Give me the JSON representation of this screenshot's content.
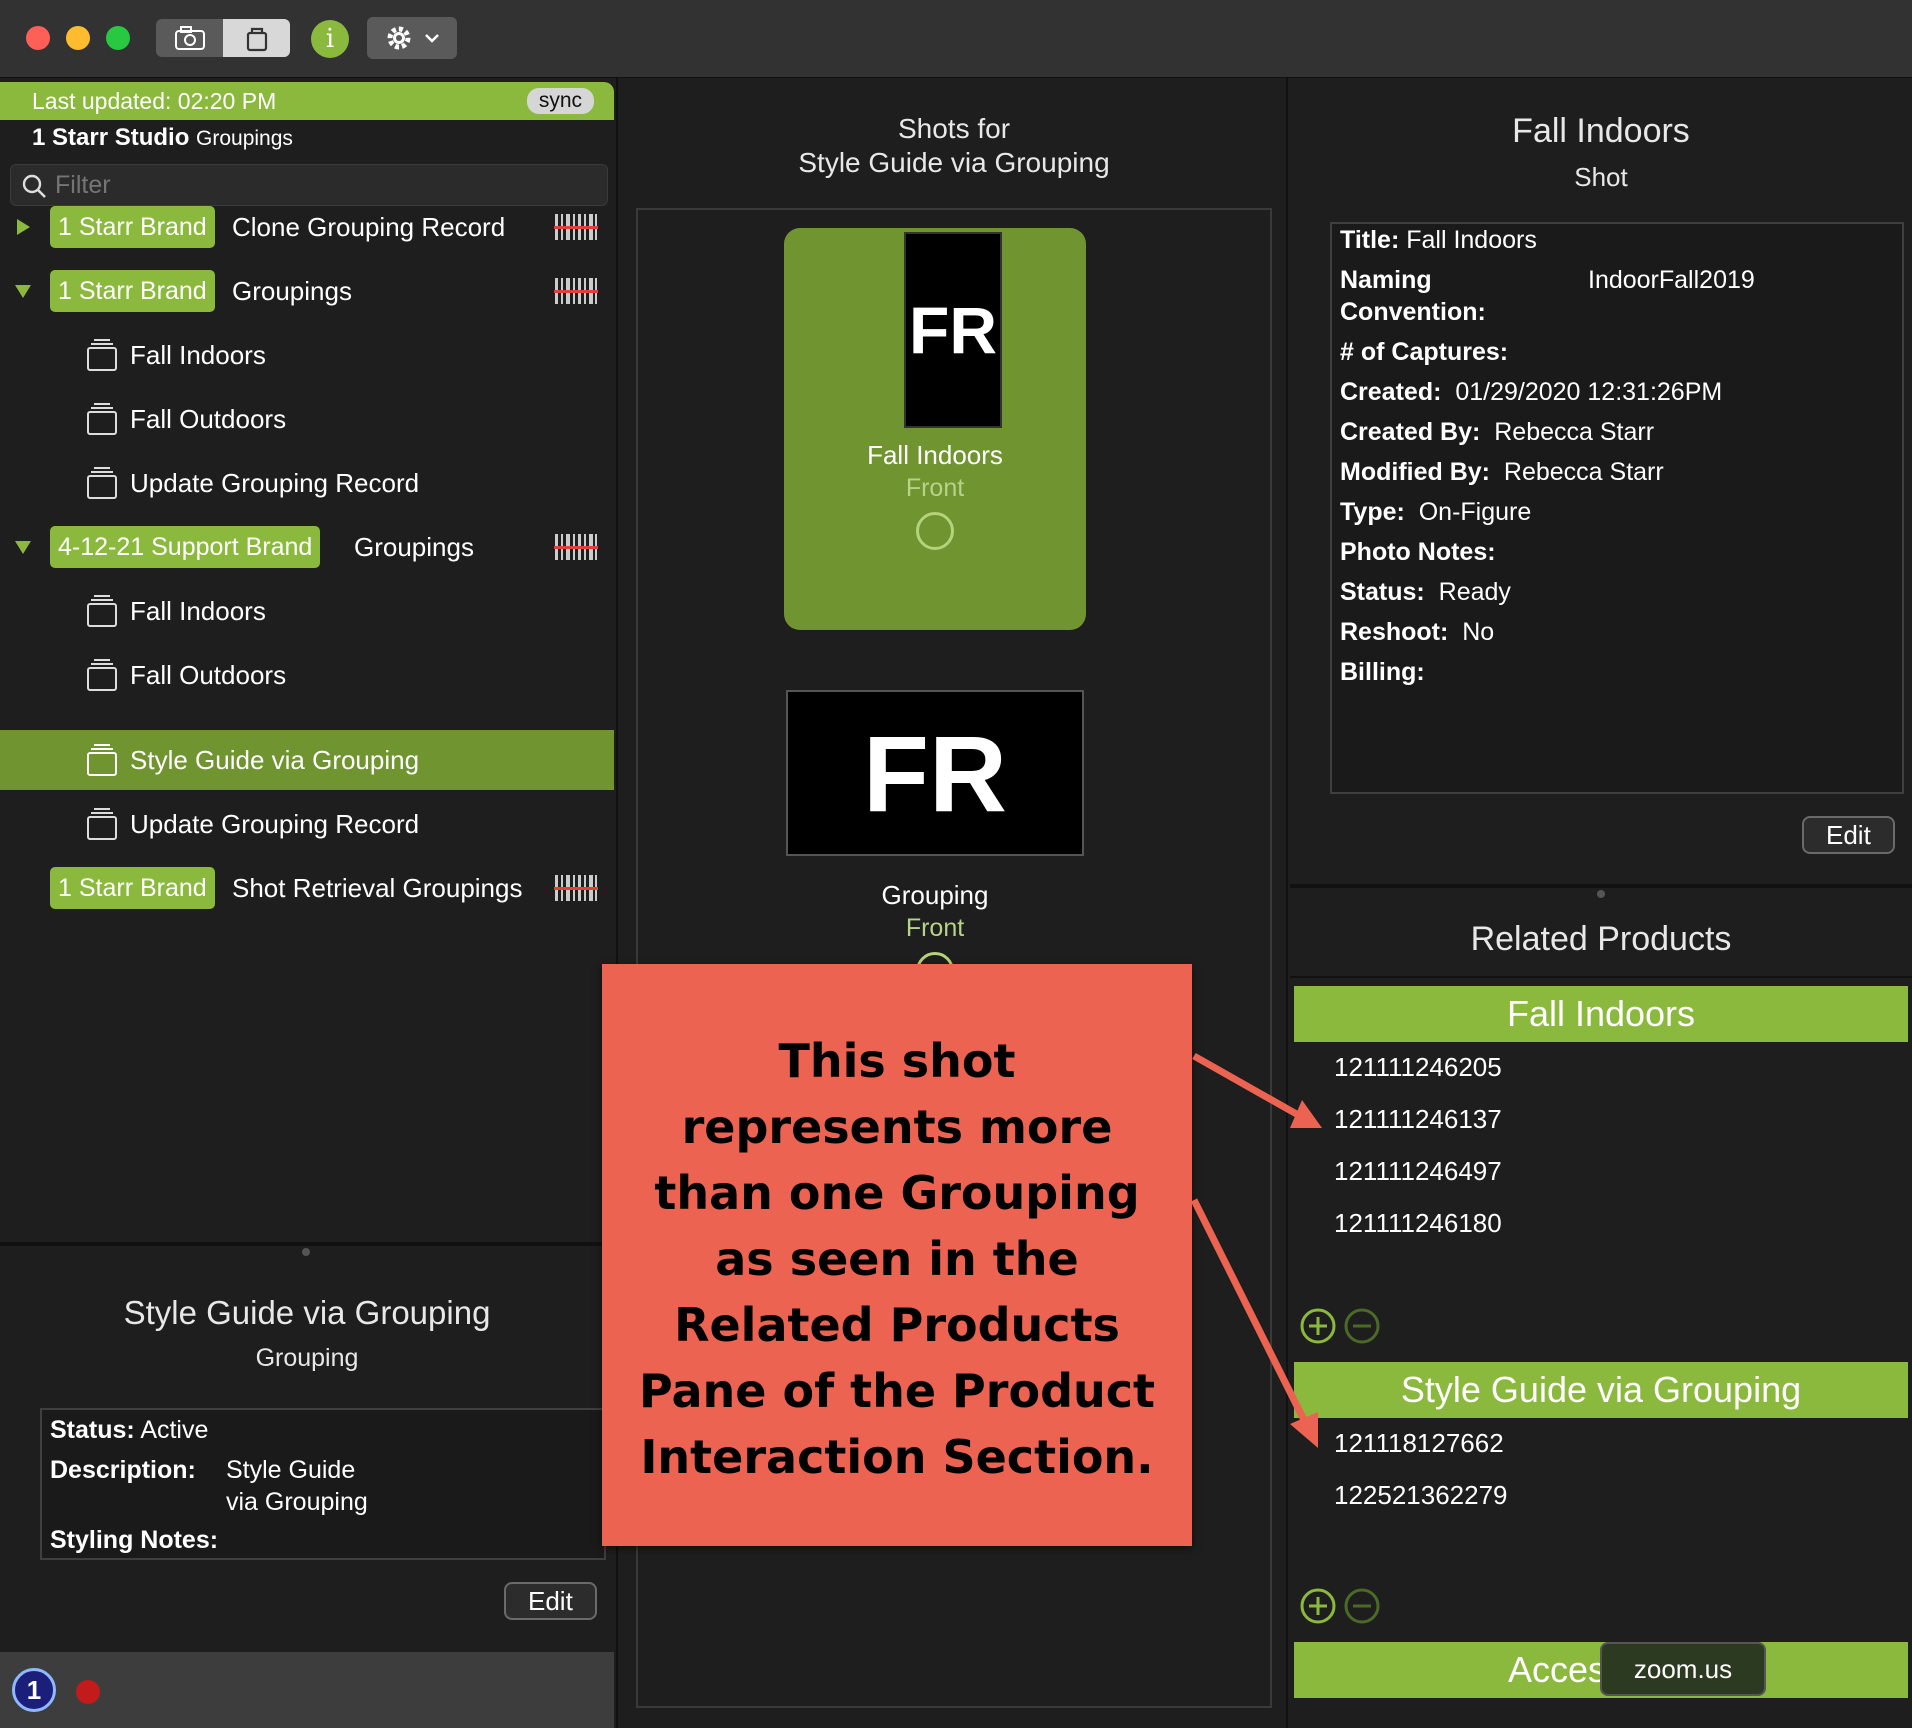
{
  "toolbar": {
    "info_label": "i"
  },
  "left": {
    "last_updated": "Last updated: 02:20 PM",
    "sync_label": "sync",
    "studio_bold": "1 Starr Studio",
    "studio_small": "Groupings",
    "filter_placeholder": "Filter",
    "tree": {
      "r1_pill": "1 Starr Brand",
      "r1_text": "Clone Grouping Record",
      "r2_pill": "1 Starr Brand",
      "r2_text": "Groupings",
      "r3_text": "Fall Indoors",
      "r4_text": "Fall Outdoors",
      "r5_text": "Update Grouping Record",
      "r6_pill": "4-12-21 Support Brand",
      "r6_text": "Groupings",
      "r7_text": "Fall Indoors",
      "r8_text": "Fall Outdoors",
      "r9_text": "Style Guide via Grouping",
      "r10_text": "Update Grouping Record",
      "r11_pill": "1 Starr Brand",
      "r11_text": "Shot Retrieval Groupings"
    },
    "detail": {
      "title": "Style Guide via Grouping",
      "subtitle": "Grouping",
      "status_label": "Status:",
      "status_value": "Active",
      "description_label": "Description:",
      "description_line1": "Style Guide",
      "description_line2": "via Grouping",
      "styling_label": "Styling Notes:",
      "edit_label": "Edit"
    },
    "bottom": {
      "op_label": "1"
    }
  },
  "middle": {
    "title_line1": "Shots for",
    "title_line2": "Style Guide via Grouping",
    "shot1": {
      "thumb": "FR",
      "name": "Fall Indoors",
      "view": "Front"
    },
    "shot2": {
      "thumb": "FR",
      "name": "Grouping",
      "view": "Front"
    }
  },
  "right": {
    "title": "Fall Indoors",
    "subtitle": "Shot",
    "fields": {
      "title_label": "Title:",
      "title_value": "Fall Indoors",
      "naming_label1": "Naming",
      "naming_label2": "Convention:",
      "naming_value": "IndoorFall2019",
      "captures_label": "# of Captures:",
      "created_label": "Created:",
      "created_value": "01/29/2020 12:31:26PM",
      "created_by_label": "Created By:",
      "created_by_value": "Rebecca Starr",
      "modified_by_label": "Modified By:",
      "modified_by_value": "Rebecca Starr",
      "type_label": "Type:",
      "type_value": "On-Figure",
      "photo_notes_label": "Photo Notes:",
      "status_label": "Status:",
      "status_value": "Ready",
      "reshoot_label": "Reshoot:",
      "reshoot_value": "No",
      "billing_label": "Billing:"
    },
    "edit_label": "Edit",
    "related_title": "Related Products",
    "group1": {
      "name": "Fall Indoors",
      "items": [
        "121111246205",
        "121111246137",
        "121111246497",
        "121111246180"
      ]
    },
    "group2": {
      "name": "Style Guide via Grouping",
      "items": [
        "121118127662",
        "122521362279"
      ]
    },
    "group3": {
      "name": "Acces"
    }
  },
  "callout": {
    "lines": [
      "This shot",
      "represents more",
      "than one Grouping",
      "as seen in the",
      "Related Products",
      "Pane of the Product",
      "Interaction Section."
    ],
    "color": "#ec6351"
  },
  "tooltip": {
    "text": "zoom.us"
  },
  "colors": {
    "accent": "#8bb93d",
    "selected": "#6f9430",
    "background": "#1e1e1e"
  }
}
